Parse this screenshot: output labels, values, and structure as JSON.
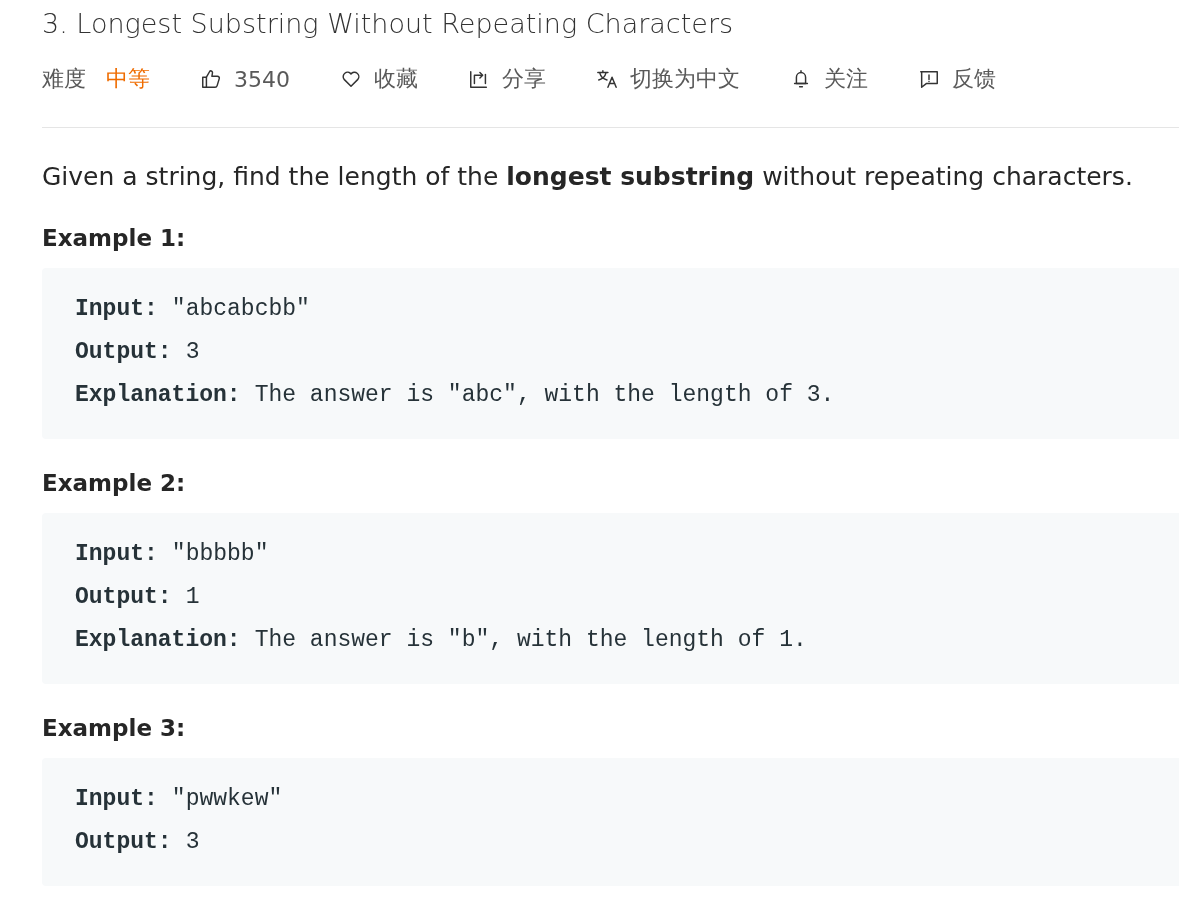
{
  "title": "3. Longest Substring Without Repeating Characters",
  "difficulty": {
    "label": "难度",
    "value": "中等",
    "color": "#ef6c00"
  },
  "actions": [
    {
      "kind": "like",
      "label": "3540"
    },
    {
      "kind": "favorite",
      "label": "收藏"
    },
    {
      "kind": "share",
      "label": "分享"
    },
    {
      "kind": "translate",
      "label": "切换为中文"
    },
    {
      "kind": "follow",
      "label": "关注"
    },
    {
      "kind": "feedback",
      "label": "反馈"
    }
  ],
  "description": "Given a string, find the length of the **longest substring** without repeating characters.",
  "examples": [
    {
      "heading": "Example 1:",
      "lines": [
        {
          "label": "Input:",
          "text": "\"abcabcbb\""
        },
        {
          "label": "Output:",
          "text": "3"
        },
        {
          "label": "Explanation:",
          "text": "The answer is \"abc\", with the length of 3."
        }
      ]
    },
    {
      "heading": "Example 2:",
      "lines": [
        {
          "label": "Input:",
          "text": "\"bbbbb\""
        },
        {
          "label": "Output:",
          "text": "1"
        },
        {
          "label": "Explanation:",
          "text": "The answer is \"b\", with the length of 1."
        }
      ]
    },
    {
      "heading": "Example 3:",
      "lines": [
        {
          "label": "Input:",
          "text": "\"pwwkew\""
        },
        {
          "label": "Output:",
          "text": "3"
        }
      ]
    }
  ]
}
